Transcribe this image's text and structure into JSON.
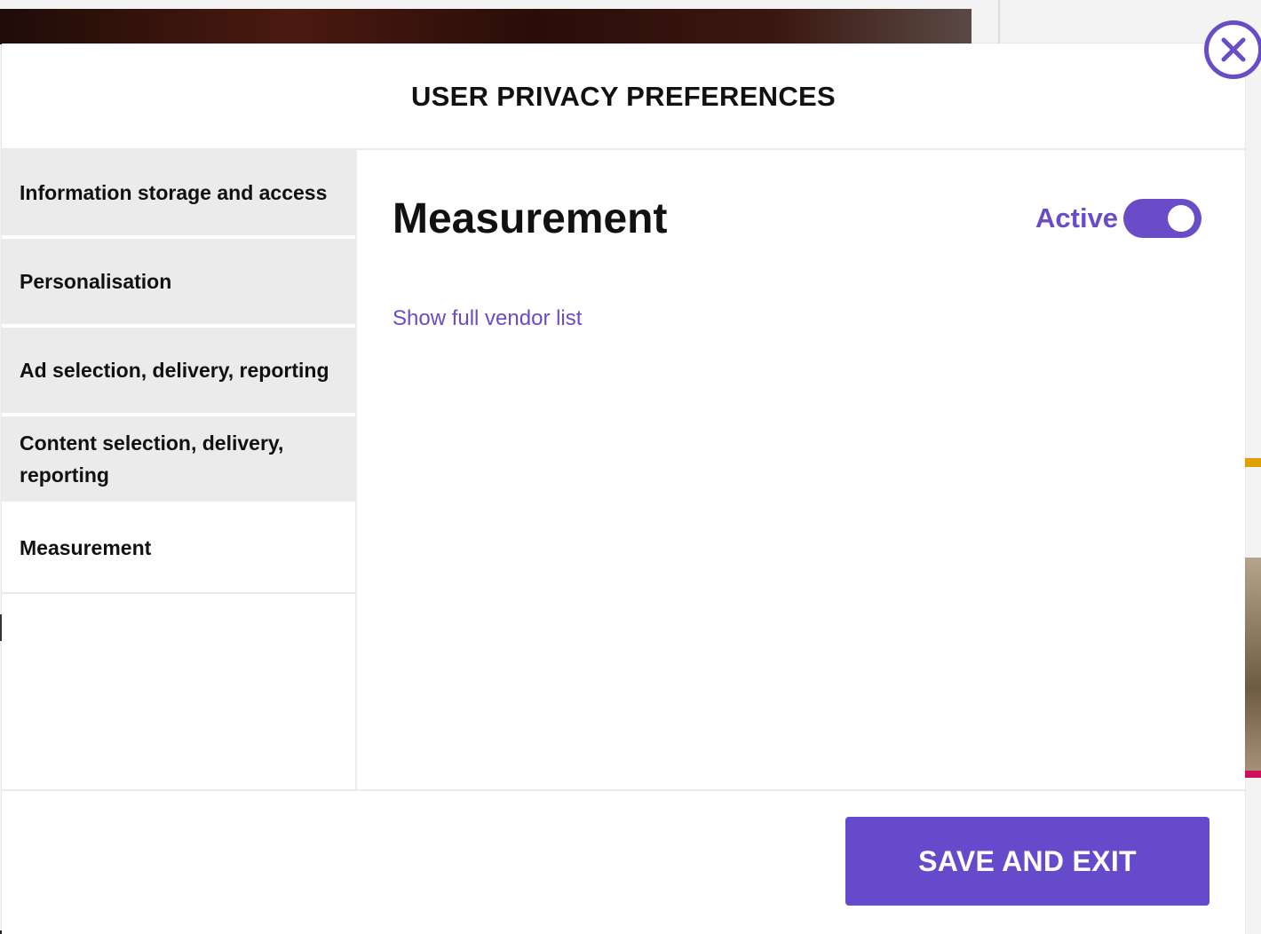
{
  "modal": {
    "title": "USER PRIVACY PREFERENCES"
  },
  "sidebar": {
    "items": [
      {
        "label": "Information storage and access",
        "selected": false
      },
      {
        "label": "Personalisation",
        "selected": false
      },
      {
        "label": "Ad selection, delivery, reporting",
        "selected": false
      },
      {
        "label": "Content selection, delivery, reporting",
        "selected": false
      },
      {
        "label": "Measurement",
        "selected": true
      }
    ]
  },
  "content": {
    "title": "Measurement",
    "status_label": "Active",
    "toggle_on": true,
    "vendor_link": "Show full vendor list"
  },
  "footer": {
    "save_label": "SAVE AND EXIT"
  },
  "colors": {
    "accent": "#654acb",
    "nav_background": "#ebebeb",
    "text": "#111111"
  },
  "icons": {
    "close": "close-icon"
  }
}
